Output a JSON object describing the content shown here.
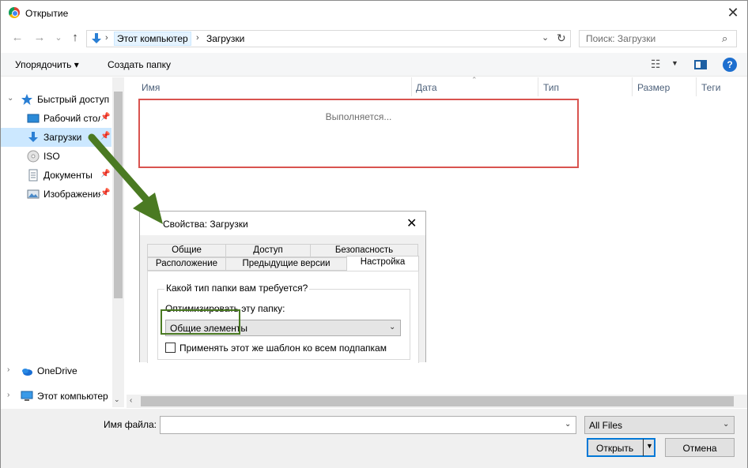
{
  "window": {
    "title": "Открытие",
    "close": "✕"
  },
  "address": {
    "breadcrumbs": [
      "Этот компьютер",
      "Загрузки"
    ],
    "separator": "›",
    "dropdown": "⌄",
    "refresh": "↻"
  },
  "nav_buttons": {
    "back": "←",
    "forward": "→",
    "recent": "⌄",
    "up": "↑"
  },
  "search": {
    "placeholder": "Поиск: Загрузки",
    "icon": "⌕"
  },
  "toolbar": {
    "organize": "Упорядочить ▾",
    "new_folder": "Создать папку",
    "view_icon": "☷",
    "view_dropdown": "▼",
    "help": "?"
  },
  "nav_pane": {
    "items": [
      {
        "label": "Быстрый доступ",
        "icon": "star-icon",
        "chevron": "⌄"
      },
      {
        "label": "Рабочий стол",
        "icon": "desktop-icon",
        "pin": "📌"
      },
      {
        "label": "Загрузки",
        "icon": "download-icon",
        "pin": "📌"
      },
      {
        "label": "ISO",
        "icon": "disc-icon"
      },
      {
        "label": "Документы",
        "icon": "document-icon",
        "pin": "📌"
      },
      {
        "label": "Изображения",
        "icon": "pictures-icon",
        "pin": "📌"
      },
      {
        "label": "OneDrive",
        "icon": "cloud-icon",
        "chevron": "›"
      },
      {
        "label": "Этот компьютер",
        "icon": "computer-icon",
        "chevron": "›"
      }
    ],
    "scroll_down": "⌄"
  },
  "columns": [
    "Имя",
    "Дата",
    "Тип",
    "Размер",
    "Теги"
  ],
  "sort_caret": "⌃",
  "file_list": {
    "status": "Выполняется..."
  },
  "hscroll_left": "‹",
  "properties": {
    "title": "Свойства: Загрузки",
    "close": "✕",
    "tabs_row1": [
      "Общие",
      "Доступ",
      "Безопасность"
    ],
    "tabs_row2": [
      "Расположение",
      "Предыдущие версии",
      "Настройка"
    ],
    "active_tab": "Настройка",
    "group_label": "Какой тип папки вам требуется?",
    "optimize_label": "Оптимизировать эту папку:",
    "optimize_value": "Общие элементы",
    "select_arrow": "⌄",
    "apply_label": "Применять этот же шаблон ко всем подпапкам"
  },
  "bottom": {
    "filename_label": "Имя файла:",
    "filename_value": "",
    "dropdown_arrow": "⌄",
    "filetype_value": "All Files",
    "open_label": "Открыть",
    "open_arrow": "▼",
    "cancel_label": "Отмена"
  },
  "colors": {
    "accent": "#0078d7",
    "highlight_red": "#d9534f",
    "highlight_green": "#4a7a22",
    "selection": "#cce8ff"
  }
}
